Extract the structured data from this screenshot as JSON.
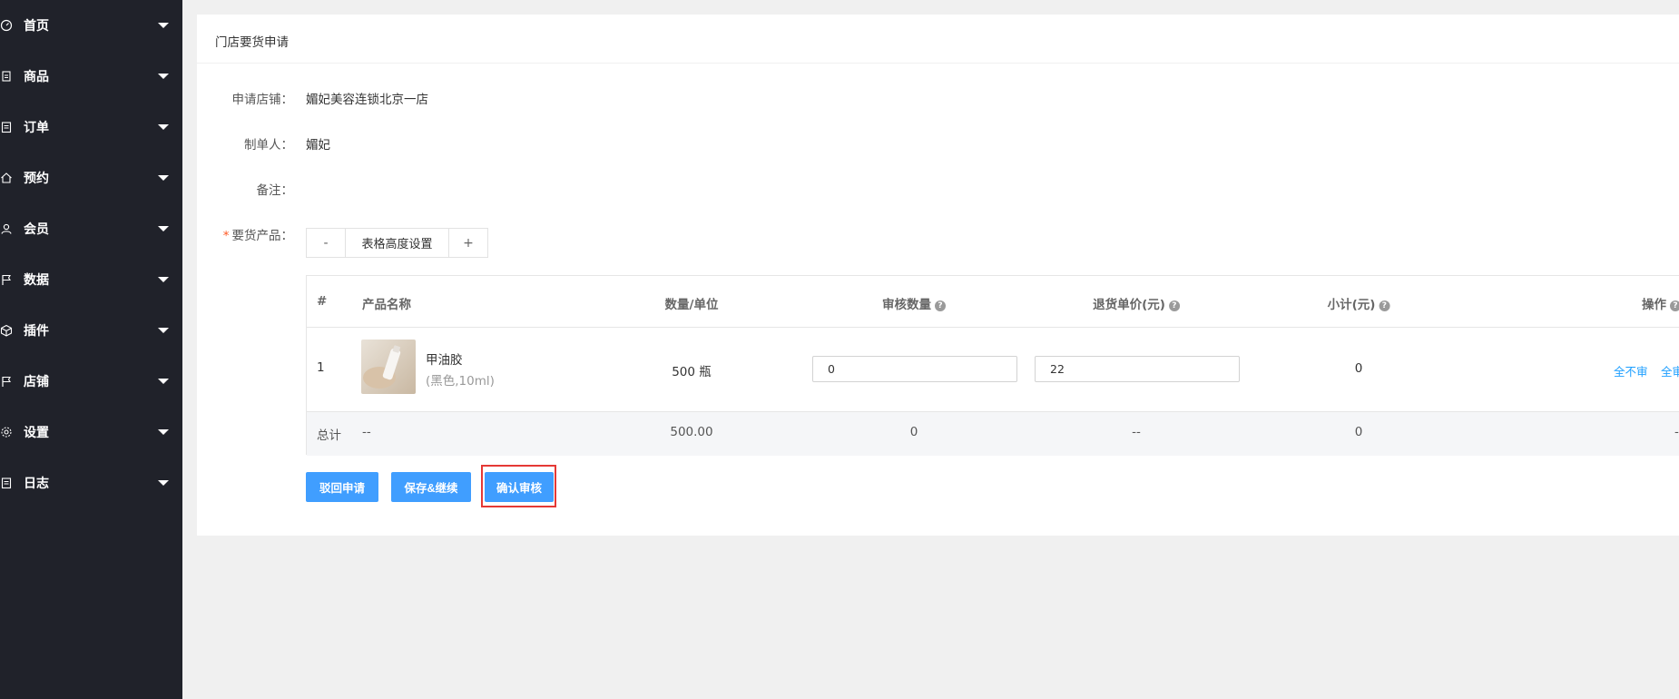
{
  "sidebar": {
    "items": [
      {
        "label": "首页",
        "icon": "dashboard-icon"
      },
      {
        "label": "商品",
        "icon": "document-icon"
      },
      {
        "label": "订单",
        "icon": "clipboard-icon"
      },
      {
        "label": "预约",
        "icon": "home-icon"
      },
      {
        "label": "会员",
        "icon": "user-icon"
      },
      {
        "label": "数据",
        "icon": "flag-icon"
      },
      {
        "label": "插件",
        "icon": "cube-icon"
      },
      {
        "label": "店铺",
        "icon": "flag-icon"
      },
      {
        "label": "设置",
        "icon": "gear-icon"
      },
      {
        "label": "日志",
        "icon": "clipboard-icon"
      }
    ]
  },
  "panel": {
    "title": "门店要货申请"
  },
  "form": {
    "store_label": "申请店铺：",
    "store_value": "媚妃美容连锁北京一店",
    "creator_label": "制单人：",
    "creator_value": "媚妃",
    "remark_label": "备注：",
    "products_label": "要货产品：",
    "required_mark": "*"
  },
  "stepper": {
    "minus": "-",
    "label": "表格高度设置",
    "plus": "+"
  },
  "table": {
    "headers": {
      "index": "#",
      "name": "产品名称",
      "qty_unit": "数量/单位",
      "audit_qty": "审核数量",
      "return_price": "退货单价(元)",
      "subtotal": "小计(元)",
      "actions": "操作"
    },
    "help_glyph": "?",
    "row": {
      "index": "1",
      "product_name": "甲油胶",
      "product_spec": "(黑色,10ml)",
      "qty_unit": "500 瓶",
      "audit_qty": "0",
      "return_price": "22",
      "subtotal": "0",
      "action_none": "全不审",
      "action_all": "全审"
    },
    "total": {
      "label": "总计",
      "name": "--",
      "qty": "500.00",
      "audit_qty": "0",
      "return_price": "--",
      "subtotal": "0",
      "actions": "-"
    }
  },
  "buttons": {
    "withdraw": "驳回申请",
    "save_continue": "保存&继续",
    "confirm": "确认审核"
  },
  "colors": {
    "sidebar_bg": "#20222a",
    "primary": "#409eff",
    "link": "#1e9fff",
    "highlight": "#e53935"
  }
}
